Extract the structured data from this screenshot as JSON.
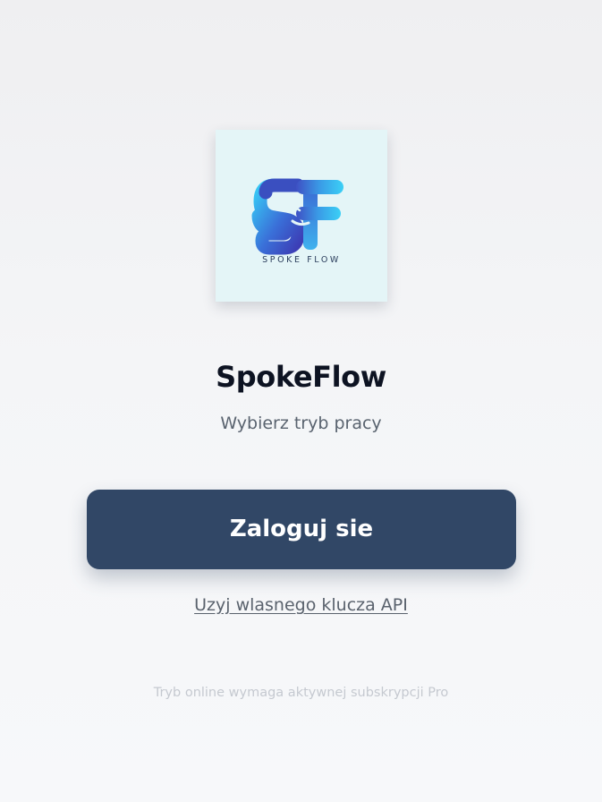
{
  "app": {
    "name": "SpokeFlow",
    "subtitle": "Wybierz tryb pracy"
  },
  "logo": {
    "monogram": "SF",
    "caption": "SPOKE FLOW",
    "icon": "spokeflow-logo",
    "colors": {
      "background": "#e4f5f7",
      "gradient_light": "#36c6f4",
      "gradient_dark": "#3d3fb8"
    }
  },
  "actions": {
    "login_label": "Zaloguj sie",
    "api_key_label": "Uzyj wlasnego klucza API"
  },
  "footer": {
    "note": "Tryb online wymaga aktywnej subskrypcji Pro"
  },
  "colors": {
    "primary_button": "#314766",
    "title_text": "#0d1322",
    "muted_text": "#59636f"
  }
}
